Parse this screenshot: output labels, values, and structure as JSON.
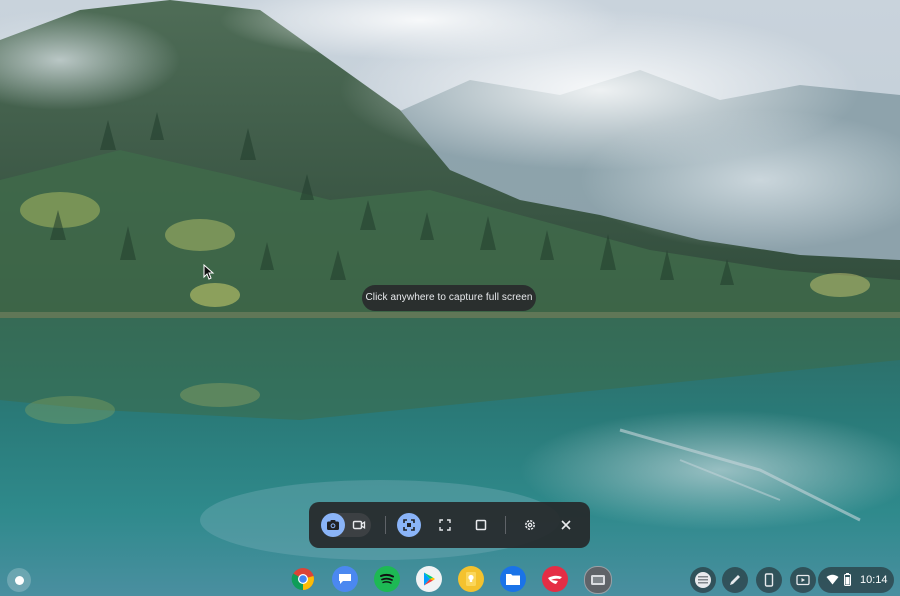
{
  "wallpaper": {
    "description_name": "misty-mountain-lake"
  },
  "capture_hint": {
    "text": "Click anywhere to capture full screen"
  },
  "capture_toolbar": {
    "mode_toggle": [
      {
        "icon": "camera-icon",
        "selected": true
      },
      {
        "icon": "video-camera-icon",
        "selected": false
      }
    ],
    "capture_types": [
      {
        "icon": "fullscreen-icon",
        "selected": true
      },
      {
        "icon": "partial-screen-icon",
        "selected": false
      },
      {
        "icon": "window-icon",
        "selected": false
      }
    ],
    "settings_icon": "gear-icon",
    "close_icon": "close-icon",
    "accent_color": "#8ab4f8"
  },
  "shelf": {
    "apps": [
      {
        "name": "chrome-app-icon"
      },
      {
        "name": "messages-app-icon"
      },
      {
        "name": "spotify-app-icon"
      },
      {
        "name": "play-store-app-icon"
      },
      {
        "name": "keep-app-icon"
      },
      {
        "name": "files-app-icon"
      },
      {
        "name": "stadia-app-icon"
      },
      {
        "name": "screenshot-app-icon"
      }
    ],
    "tray": {
      "time": "10:14"
    }
  }
}
